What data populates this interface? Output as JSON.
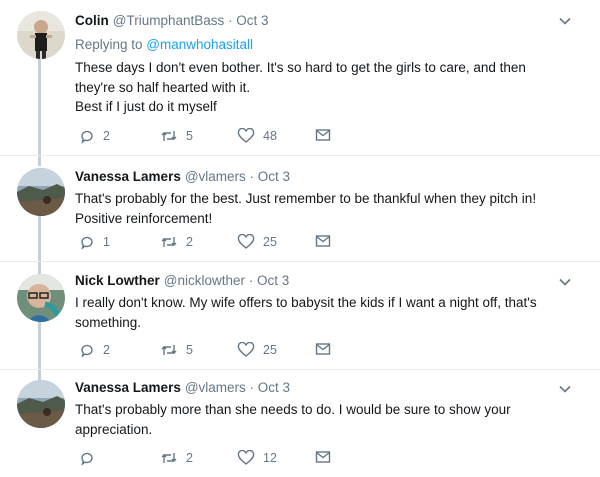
{
  "tweets": [
    {
      "name": "Colin",
      "handle": "@TriumphantBass",
      "time": "Oct 3",
      "replying_prefix": "Replying to ",
      "replying_to": "@manwhohasitall",
      "lines": [
        "These days I don't even bother. It's so hard to get the girls to care, and then",
        "they're so half hearted with it.",
        "Best if I just do it myself"
      ],
      "replies": "2",
      "retweets": "5",
      "likes": "48"
    },
    {
      "name": "Vanessa Lamers",
      "handle": "@vlamers",
      "time": "Oct 3",
      "lines": [
        "That's probably for the best. Just remember to be thankful when they pitch in!",
        "Positive reinforcement!"
      ],
      "replies": "1",
      "retweets": "2",
      "likes": "25"
    },
    {
      "name": "Nick Lowther",
      "handle": "@nicklowther",
      "time": "Oct 3",
      "lines": [
        "I really don't know. My wife offers to babysit the kids if I want a night off, that's",
        "something."
      ],
      "replies": "2",
      "retweets": "5",
      "likes": "25"
    },
    {
      "name": "Vanessa Lamers",
      "handle": "@vlamers",
      "time": "Oct 3",
      "lines": [
        "That's probably more than she needs to do. I would be sure to show your",
        "appreciation."
      ],
      "replies": "",
      "retweets": "2",
      "likes": "12"
    }
  ],
  "icons": {
    "reply": "reply-icon",
    "retweet": "retweet-icon",
    "like": "heart-icon",
    "dm": "envelope-icon",
    "more": "chevron-down-icon"
  },
  "colors": {
    "text": "#14171a",
    "muted": "#657786",
    "link": "#1da1f2",
    "thread_line": "#c4cfd6"
  }
}
